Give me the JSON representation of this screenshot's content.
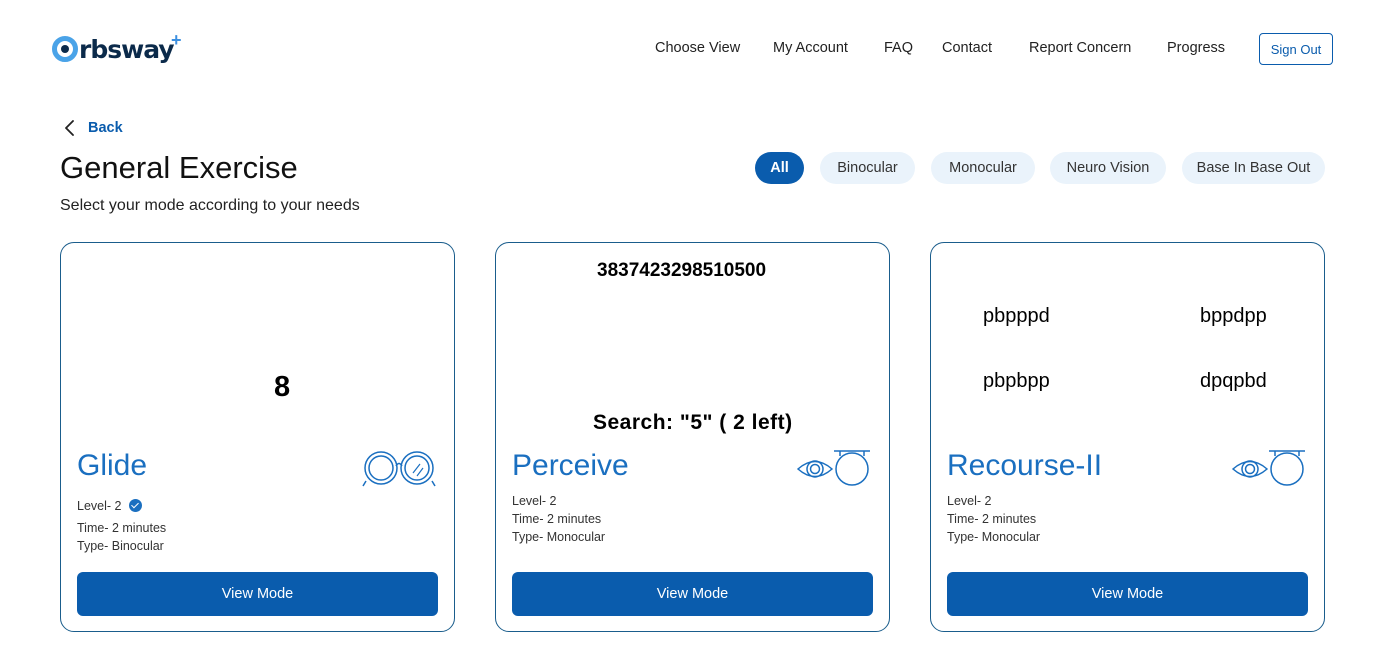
{
  "brand": {
    "name": "rbsway",
    "plus": "+"
  },
  "nav": {
    "items": [
      "Choose View",
      "My Account",
      "FAQ",
      "Contact",
      "Report Concern",
      "Progress"
    ],
    "sign_out": "Sign Out"
  },
  "page": {
    "back": "Back",
    "title": "General Exercise",
    "subtitle": "Select your mode according to your needs"
  },
  "filters": {
    "items": [
      "All",
      "Binocular",
      "Monocular",
      "Neuro Vision",
      "Base In Base Out"
    ],
    "active": "All"
  },
  "cards": [
    {
      "title": "Glide",
      "level": "Level- 2",
      "verified": true,
      "time": "Time- 2 minutes",
      "type": "Type- Binocular",
      "button": "View Mode",
      "icon": "glasses-icon",
      "preview": {
        "digit": "8"
      }
    },
    {
      "title": "Perceive",
      "level": "Level- 2",
      "verified": false,
      "time": "Time- 2 minutes",
      "type": "Type- Monocular",
      "button": "View Mode",
      "icon": "eye-lens-icon",
      "preview": {
        "number": "3837423298510500",
        "search": "Search: \"5\" ( 2 left)"
      }
    },
    {
      "title": "Recourse-II",
      "level": "Level- 2",
      "verified": false,
      "time": "Time- 2 minutes",
      "type": "Type- Monocular",
      "button": "View Mode",
      "icon": "eye-lens-icon",
      "preview": {
        "words": [
          "pbpppd",
          "bppdpp",
          "pbpbpp",
          "dpqpbd"
        ]
      }
    }
  ],
  "colors": {
    "accent": "#0a5cad",
    "title_blue": "#1a6fc0",
    "chip_bg": "#eaf3fb",
    "border": "#1a5d8c"
  }
}
